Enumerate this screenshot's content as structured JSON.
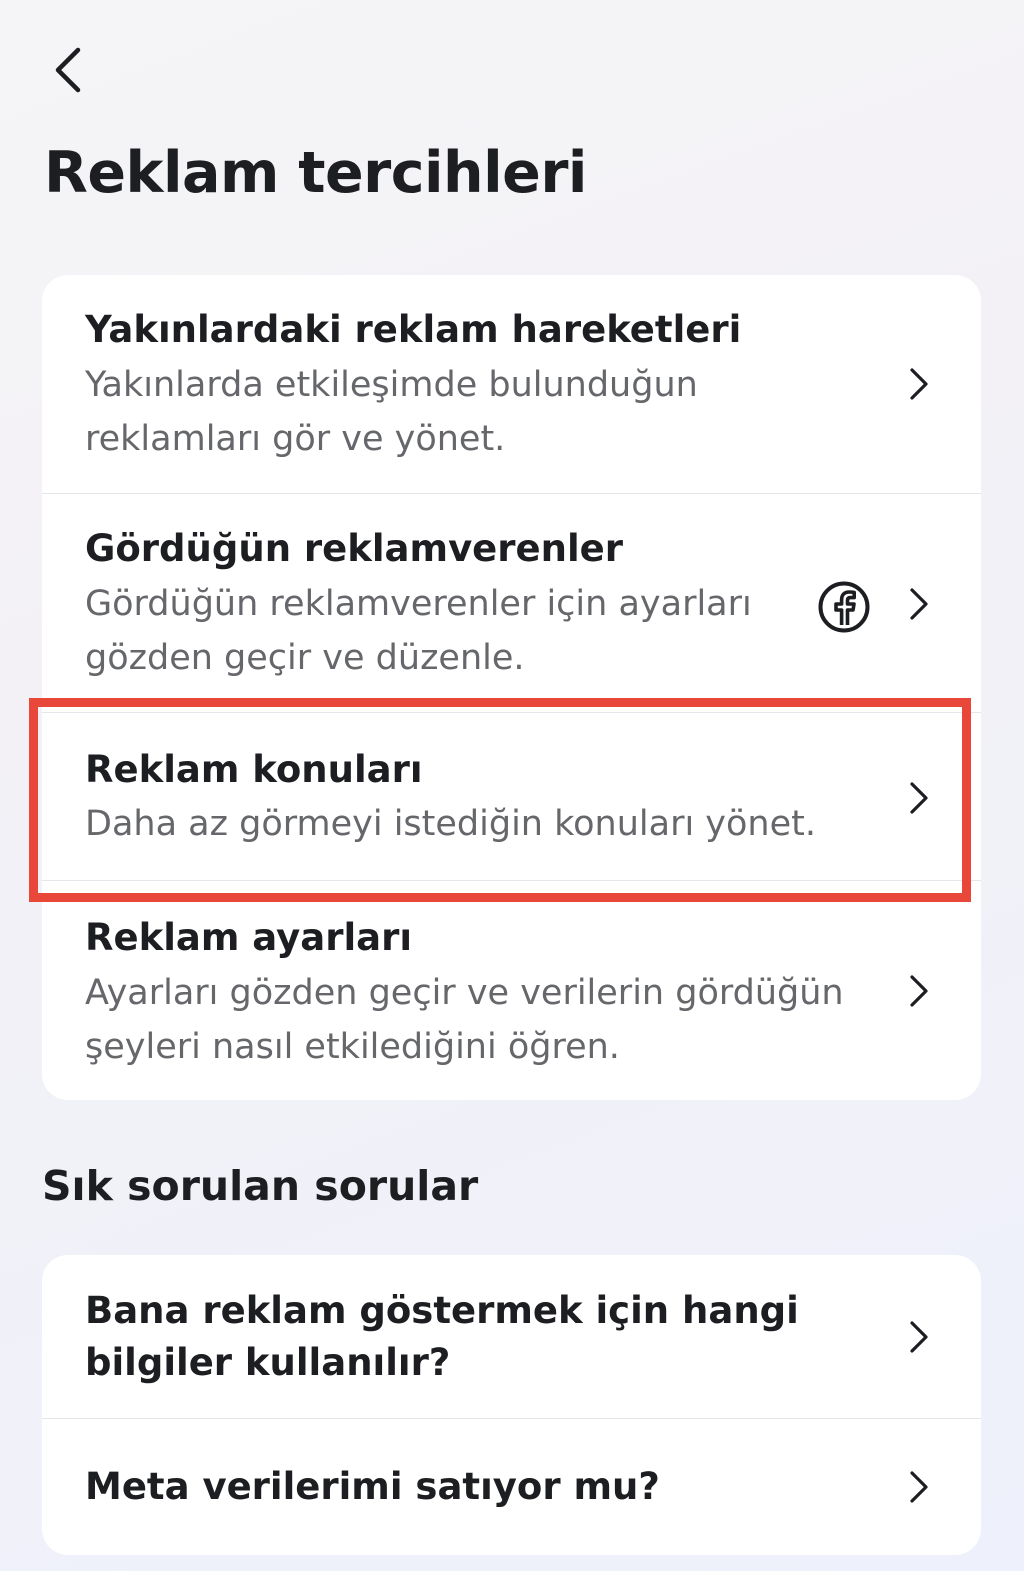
{
  "header": {
    "title": "Reklam tercihleri"
  },
  "preferences": {
    "items": [
      {
        "title": "Yakınlardaki reklam hareketleri",
        "description": "Yakınlarda etkileşimde bulunduğun reklamları gör ve yönet."
      },
      {
        "title": "Gördüğün reklamverenler",
        "description": "Gördüğün reklamverenler için ayarları gözden geçir ve düzenle.",
        "icon": "facebook-icon"
      },
      {
        "title": "Reklam konuları",
        "description": "Daha az görmeyi istediğin konuları yönet.",
        "highlighted": true
      },
      {
        "title": "Reklam ayarları",
        "description": "Ayarları gözden geçir ve verilerin gördüğün şeyleri nasıl etkilediğini öğren."
      }
    ]
  },
  "faq": {
    "heading": "Sık sorulan sorular",
    "items": [
      {
        "question": "Bana reklam göstermek için hangi bilgiler kullanılır?"
      },
      {
        "question": "Meta verilerimi satıyor mu?"
      }
    ]
  },
  "colors": {
    "highlight": "#e8473a",
    "text_primary": "#1c1e21",
    "text_secondary": "#65676b"
  }
}
